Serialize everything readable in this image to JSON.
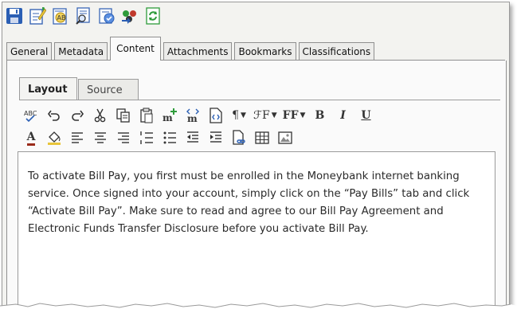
{
  "toolbar": {
    "icons": [
      "save-icon",
      "edit-properties-icon",
      "translate-icon",
      "preview-icon",
      "workflow-icon",
      "move-icon",
      "refresh-icon"
    ]
  },
  "tabs": [
    {
      "label": "General"
    },
    {
      "label": "Metadata"
    },
    {
      "label": "Content",
      "active": true
    },
    {
      "label": "Attachments"
    },
    {
      "label": "Bookmarks"
    },
    {
      "label": "Classifications"
    }
  ],
  "editor_tabs": [
    {
      "label": "Layout",
      "active": true
    },
    {
      "label": "Source"
    }
  ],
  "editor_toolbar": {
    "format_paragraph": "¶",
    "font_family": "ℱF",
    "font_size": "FF",
    "bold": "B",
    "italic": "I",
    "underline": "U",
    "font_color": "A"
  },
  "editor": {
    "text": "To activate Bill Pay, you first must be enrolled in the Moneybank internet banking service. Once signed into your account, simply click on the “Pay Bills” tab and click “Activate Bill Pay”. Make sure to read and agree to our Bill Pay Agreement and Electronic Funds Transfer Disclosure before you activate Bill Pay."
  },
  "colors": {
    "accent_blue": "#2b5fb4",
    "refresh_green": "#2e9b3a",
    "edit_yellow": "#e8c53a"
  }
}
